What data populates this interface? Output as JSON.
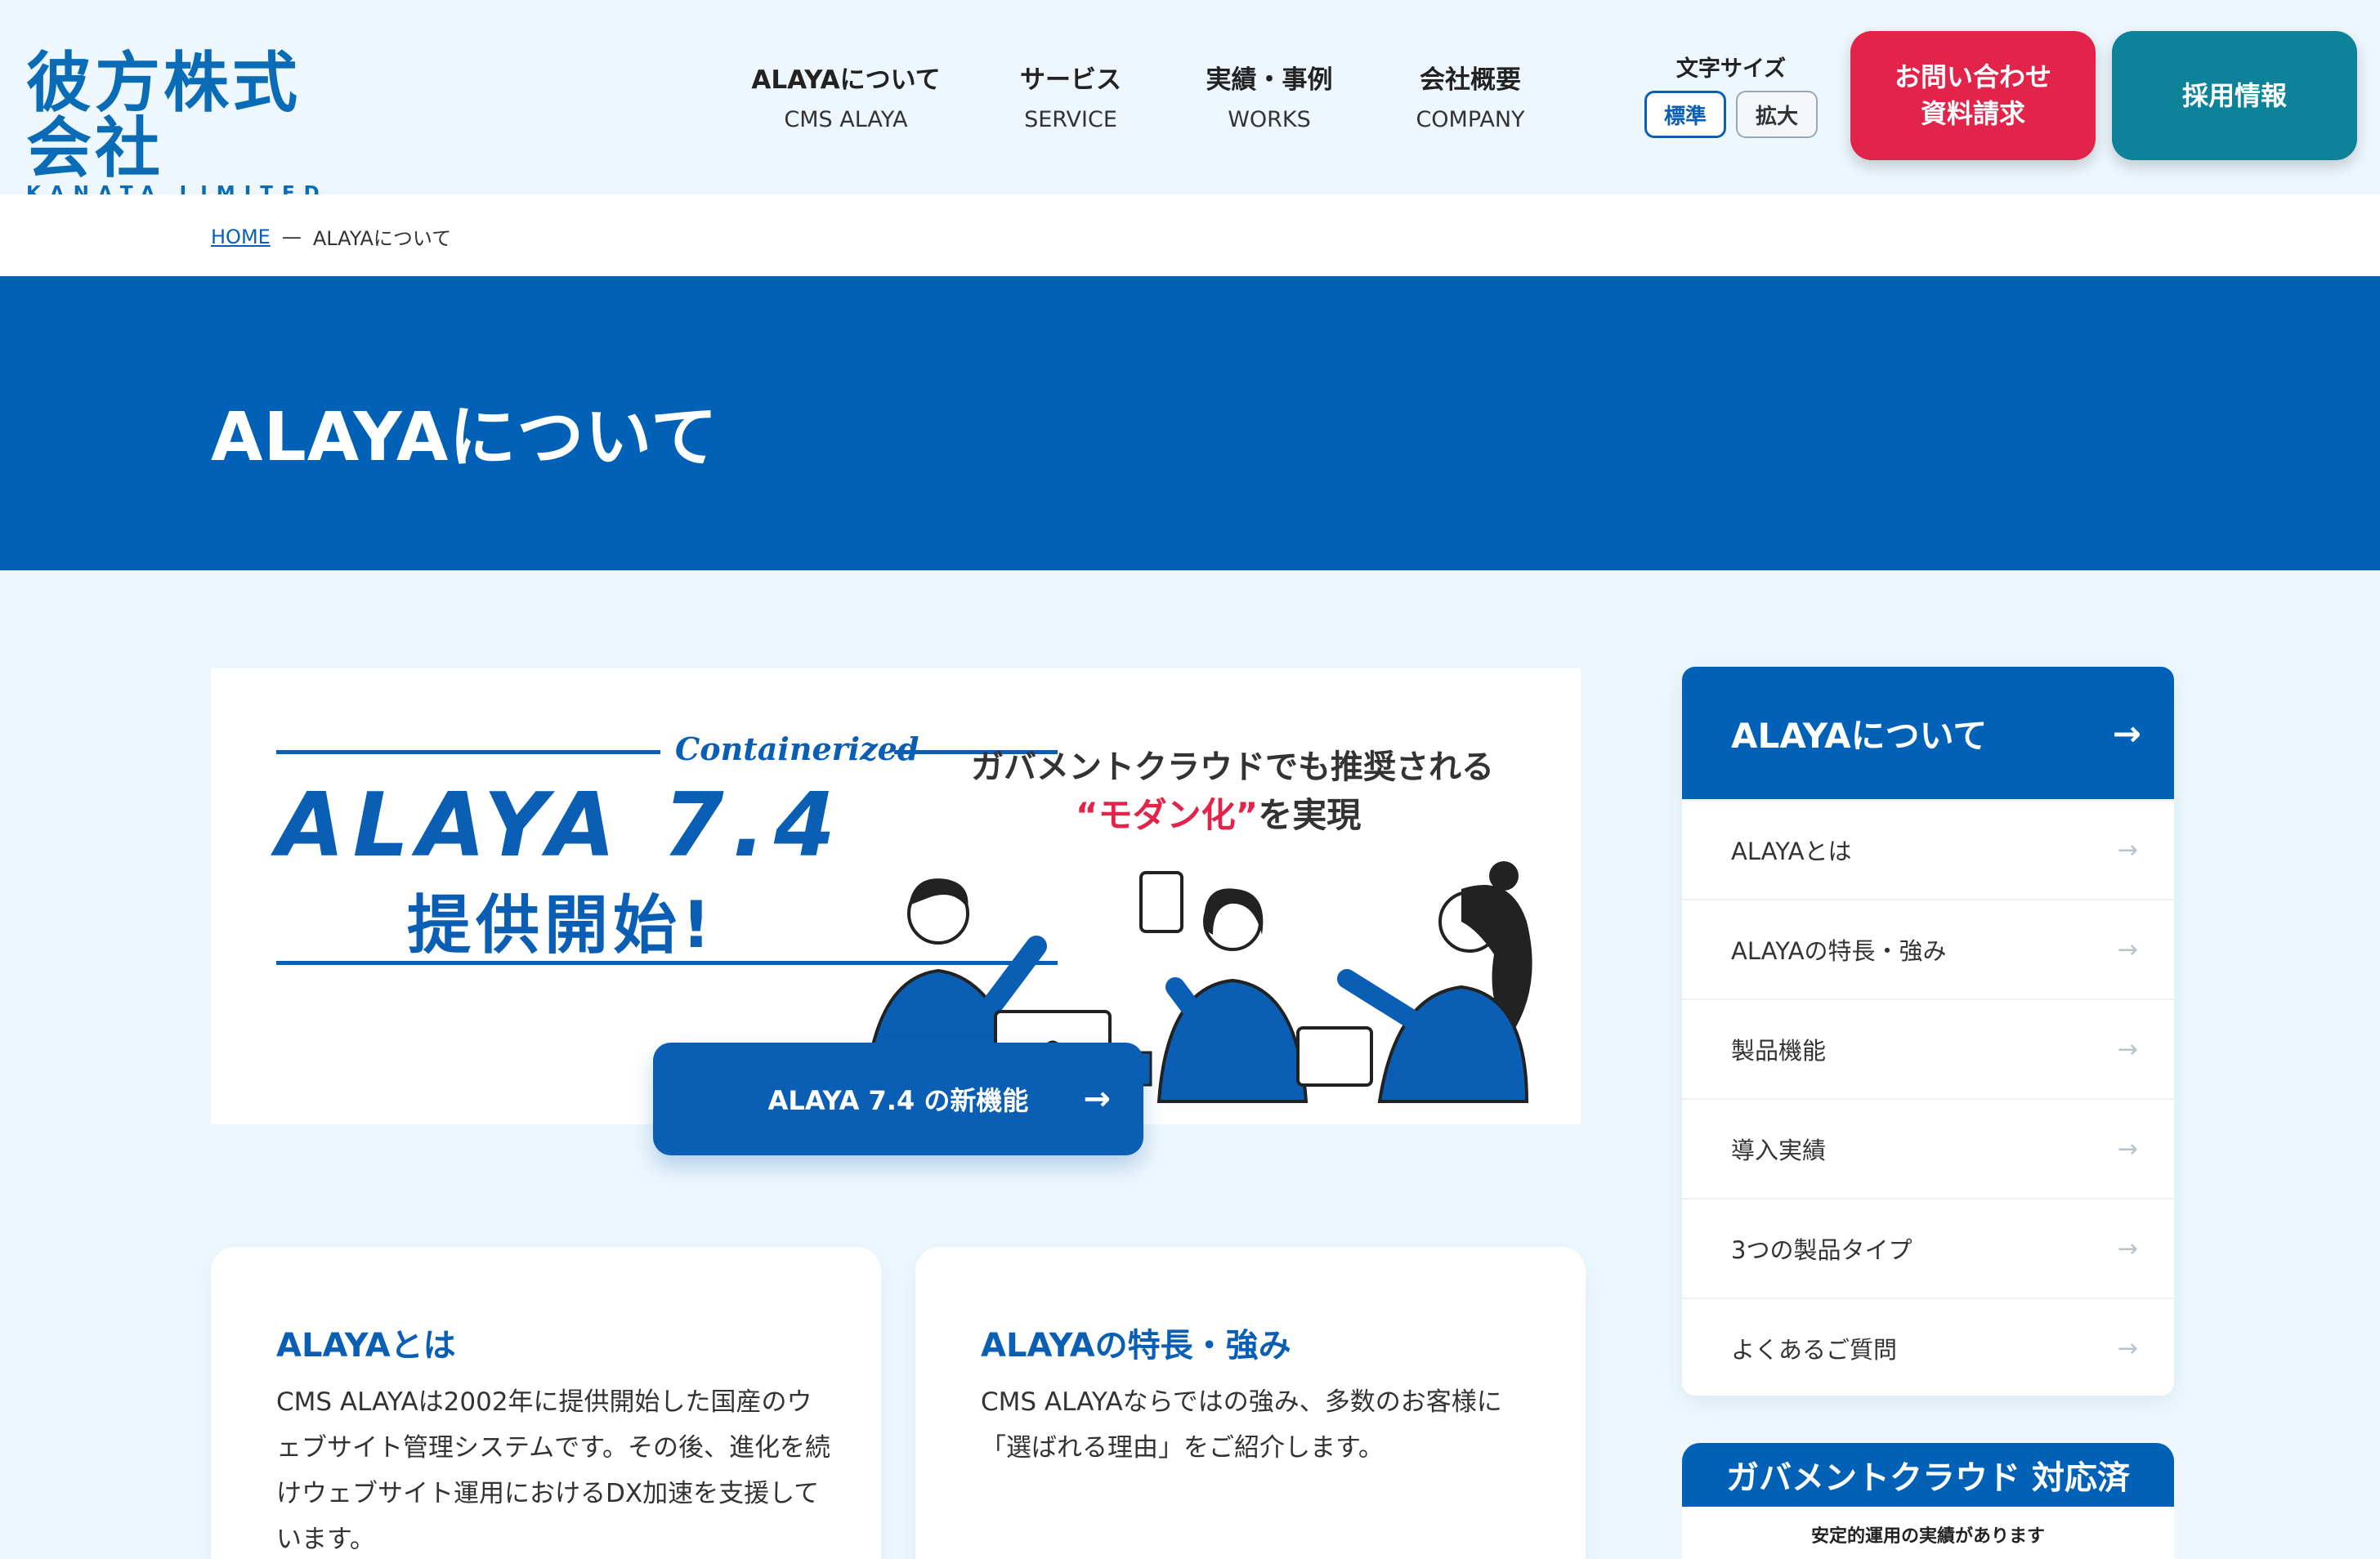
{
  "header": {
    "logo_jp": "彼方株式会社",
    "logo_en": "KANATA LIMITED",
    "nav": [
      {
        "jp": "ALAYAについて",
        "en": "CMS ALAYA"
      },
      {
        "jp": "サービス",
        "en": "SERVICE"
      },
      {
        "jp": "実績・事例",
        "en": "WORKS"
      },
      {
        "jp": "会社概要",
        "en": "COMPANY"
      }
    ],
    "font_size": {
      "label": "文字サイズ",
      "standard": "標準",
      "large": "拡大"
    },
    "contact_line1": "お問い合わせ",
    "contact_line2": "資料請求",
    "recruit": "採用情報"
  },
  "breadcrumb": {
    "home": "HOME",
    "separator": "—",
    "current": "ALAYAについて"
  },
  "hero": {
    "title": "ALAYAについて"
  },
  "banner": {
    "contained": "Containerized",
    "product": "ALAYA 7.4",
    "launch": "提供開始!",
    "gov_line": "ガバメントクラウドでも推奨される",
    "modern_open": "“",
    "modern_word": "モダン化",
    "modern_close": "”",
    "modern_rest": "を実現",
    "button": "ALAYA 7.4 の新機能",
    "button_arrow": "→"
  },
  "cards": [
    {
      "title": "ALAYAとは",
      "body": "CMS ALAYAは2002年に提供開始した国産のウェブサイト管理システムです。その後、進化を続けウェブサイト運用におけるDX加速を支援しています。"
    },
    {
      "title": "ALAYAの特長・強み",
      "body": "CMS ALAYAならではの強み、多数のお客様に「選ばれる理由」をご紹介します。"
    }
  ],
  "sidebar": {
    "title": "ALAYAについて",
    "arrow": "→",
    "items": [
      {
        "label": "ALAYAとは"
      },
      {
        "label": "ALAYAの特長・強み"
      },
      {
        "label": "製品機能"
      },
      {
        "label": "導入実績"
      },
      {
        "label": "3つの製品タイプ"
      },
      {
        "label": "よくあるご質問"
      }
    ]
  },
  "gov_badge": {
    "title": "ガバメントクラウド 対応済",
    "sub": "安定的運用の実績があります"
  },
  "colors": {
    "primary": "#0061b6",
    "accent_red": "#e2244b",
    "teal": "#0d8299",
    "bg": "#edf7fd"
  }
}
